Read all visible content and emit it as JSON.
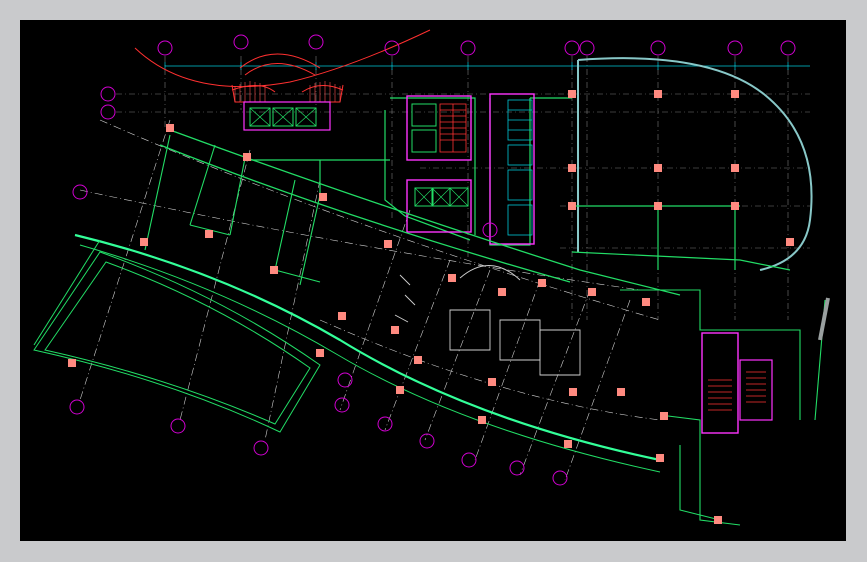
{
  "colors": {
    "window_bg": "#c9cacc",
    "canvas_bg": "#000000",
    "grid_cyan": "#00c8d8",
    "grid_dim": "#7a7a7a",
    "grid_white": "#cfcfcf",
    "wall_green": "#22dd66",
    "wall_magenta": "#ff33ff",
    "column_pink": "#ff8a80",
    "stair_red": "#ff3333",
    "bubble_magenta": "#d000d0",
    "curtain_glass": "#33ff99",
    "landscape_red": "#ff3030"
  },
  "grid_bubbles": [
    {
      "id": "b01"
    },
    {
      "id": "b02"
    },
    {
      "id": "b03"
    },
    {
      "id": "b04"
    },
    {
      "id": "b05"
    },
    {
      "id": "b06"
    },
    {
      "id": "b07"
    },
    {
      "id": "b08"
    },
    {
      "id": "b09"
    },
    {
      "id": "b10"
    },
    {
      "id": "b11"
    },
    {
      "id": "b12"
    },
    {
      "id": "b13"
    },
    {
      "id": "b14"
    },
    {
      "id": "b15"
    },
    {
      "id": "b16"
    },
    {
      "id": "b17"
    },
    {
      "id": "b18"
    },
    {
      "id": "b19"
    },
    {
      "id": "b20"
    },
    {
      "id": "b21"
    },
    {
      "id": "b22"
    },
    {
      "id": "b23"
    },
    {
      "id": "b24"
    }
  ],
  "icons": [
    "elevator-icon",
    "stair-icon",
    "grid-bubble-icon"
  ]
}
